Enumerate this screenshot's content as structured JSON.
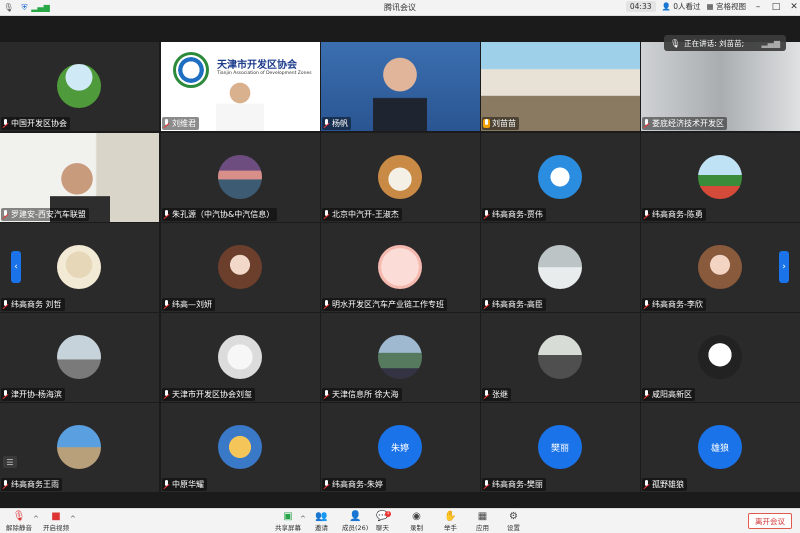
{
  "app_title": "腾讯会议",
  "titlebar": {
    "time": "04:33",
    "viewers": "0人看过",
    "view_mode": "宫格视图"
  },
  "speaking": {
    "label": "正在讲话: 刘苗苗;"
  },
  "participants": [
    {
      "name": "中国开发区协会",
      "avatar": "photo-grass"
    },
    {
      "name": "刘维君",
      "avatar": "video-tianjin"
    },
    {
      "name": "杨帆",
      "avatar": "video-glasses"
    },
    {
      "name": "刘苗苗",
      "avatar": "video-meeting-room"
    },
    {
      "name": "娄底经济技术开发区",
      "avatar": "video-blur"
    },
    {
      "name": "罗建安-西安汽车联盟",
      "avatar": "video-office"
    },
    {
      "name": "朱孔源（中汽协&中汽信息）",
      "avatar": "photo-lake"
    },
    {
      "name": "北京中汽开-王淑杰",
      "avatar": "photo-dog"
    },
    {
      "name": "纬高商务-贾伟",
      "avatar": "photo-doraemon"
    },
    {
      "name": "纬高商务-陈勇",
      "avatar": "photo-tree"
    },
    {
      "name": "纬高商务 刘哲",
      "avatar": "photo-sketch"
    },
    {
      "name": "纬高—刘妍",
      "avatar": "photo-woman"
    },
    {
      "name": "明水开发区汽车产业链工作专班",
      "avatar": "photo-pink"
    },
    {
      "name": "纬高商务-高臣",
      "avatar": "photo-snow"
    },
    {
      "name": "纬高商务-李欣",
      "avatar": "photo-girl"
    },
    {
      "name": "津开协-杨海滨",
      "avatar": "photo-runner"
    },
    {
      "name": "天津市开发区协会刘玺",
      "avatar": "photo-bird"
    },
    {
      "name": "天津信息所 徐大海",
      "avatar": "photo-mountain"
    },
    {
      "name": "张继",
      "avatar": "photo-street"
    },
    {
      "name": "咸阳高新区",
      "avatar": "photo-sketch-man"
    },
    {
      "name": "纬高商务王雨",
      "avatar": "photo-gate"
    },
    {
      "name": "中原华耀",
      "avatar": "photo-cartoon"
    },
    {
      "name": "纬高商务-朱婷",
      "avatar": "text",
      "avatar_text": "朱婷"
    },
    {
      "name": "纬高商务-樊丽",
      "avatar": "text",
      "avatar_text": "樊丽"
    },
    {
      "name": "孤野雄狼",
      "avatar": "text",
      "avatar_text": "雄狼"
    }
  ],
  "tianjin_banner": {
    "title": "天津市开发区协会",
    "subtitle": "Tianjin Association of Development Zones"
  },
  "toolbar": {
    "unmute": "解除静音",
    "video": "开启视频",
    "share": "共享屏幕",
    "invite": "邀请",
    "members": "成员(26)",
    "chat": "聊天",
    "record": "录制",
    "hand": "举手",
    "apps": "应用",
    "settings": "设置",
    "leave": "离开会议",
    "chat_badge": "1"
  },
  "colors": {
    "accent": "#1a73e8",
    "leave": "#d33333"
  }
}
